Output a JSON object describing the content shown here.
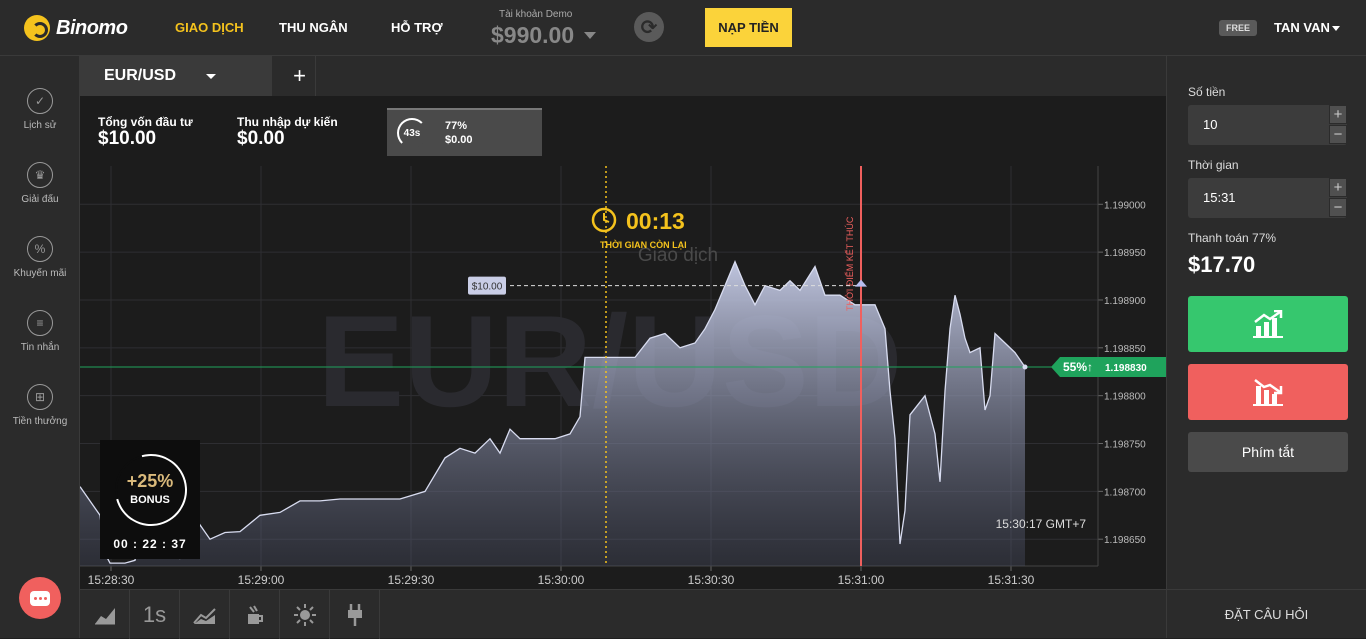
{
  "header": {
    "brand": "Binomo",
    "nav": {
      "trade": "GIAO DỊCH",
      "cashier": "THU NGÂN",
      "support": "HỖ TRỢ"
    },
    "account_label": "Tài khoản Demo",
    "balance": "$990.00",
    "deposit_label": "NẠP TIỀN",
    "free_badge": "FREE",
    "username": "TAN VAN"
  },
  "sidebar": {
    "items": [
      {
        "label": "Lịch sử",
        "icon": "check-circle-icon"
      },
      {
        "label": "Giải đấu",
        "icon": "trophy-icon"
      },
      {
        "label": "Khuyến mãi",
        "icon": "percent-icon"
      },
      {
        "label": "Tin nhắn",
        "icon": "message-lines-icon"
      },
      {
        "label": "Tiền thưởng",
        "icon": "gift-icon"
      }
    ]
  },
  "asset_tab": {
    "name": "EUR/USD",
    "add": "+"
  },
  "info": {
    "invest_label": "Tổng vốn đầu tư",
    "invest_value": "$10.00",
    "income_label": "Thu nhập dự kiến",
    "income_value": "$0.00",
    "deal": {
      "timer": "43s",
      "percent": "77%",
      "amount": "$0.00"
    }
  },
  "chart_data": {
    "type": "area",
    "watermark": "EUR/USD",
    "countdown": "00:13",
    "countdown_label": "THỜI GIAN CÒN LẠI",
    "trade_label": "Giao dịch",
    "expiry_label": "THỜI ĐIỂM KẾT THÚC",
    "deal_tag": "$10.00",
    "current_tag_pct": "55%↑",
    "current_price": "1.198830",
    "server_time": "15:30:17 GMT+7",
    "x_ticks": [
      "15:28:30",
      "15:29:00",
      "15:29:30",
      "15:30:00",
      "15:30:30",
      "15:31:00",
      "15:31:30"
    ],
    "y_ticks": [
      "1.199000",
      "1.198950",
      "1.198900",
      "1.198850",
      "1.198800",
      "1.198750",
      "1.198700",
      "1.198650"
    ],
    "ylim": [
      1.198622,
      1.19904
    ],
    "deal_price": 1.198915,
    "purchase_time_s": 105,
    "expiry_time_s": 150,
    "series": [
      [
        0,
        1.198705
      ],
      [
        4,
        1.198675
      ],
      [
        5,
        1.198635
      ],
      [
        6,
        1.198625
      ],
      [
        9,
        1.198625
      ],
      [
        11,
        1.198628
      ],
      [
        12,
        1.198655
      ],
      [
        15,
        1.198645
      ],
      [
        17,
        1.198665
      ],
      [
        18,
        1.19865
      ],
      [
        20,
        1.19863
      ],
      [
        22,
        1.198645
      ],
      [
        24,
        1.198665
      ],
      [
        26,
        1.19865
      ],
      [
        29,
        1.198657
      ],
      [
        32,
        1.198658
      ],
      [
        36,
        1.198675
      ],
      [
        40,
        1.198678
      ],
      [
        44,
        1.19869
      ],
      [
        48,
        1.19869
      ],
      [
        52,
        1.198692
      ],
      [
        56,
        1.198692
      ],
      [
        60,
        1.198692
      ],
      [
        64,
        1.198692
      ],
      [
        69,
        1.1987
      ],
      [
        73,
        1.198735
      ],
      [
        76,
        1.198745
      ],
      [
        79,
        1.19874
      ],
      [
        82,
        1.198755
      ],
      [
        84,
        1.19874
      ],
      [
        86,
        1.198765
      ],
      [
        88,
        1.198755
      ],
      [
        91,
        1.198755
      ],
      [
        95,
        1.198755
      ],
      [
        98,
        1.19876
      ],
      [
        100,
        1.198778
      ],
      [
        101,
        1.19884
      ],
      [
        103,
        1.19884
      ],
      [
        107,
        1.19884
      ],
      [
        111,
        1.19884
      ],
      [
        114,
        1.19886
      ],
      [
        117,
        1.198865
      ],
      [
        120,
        1.19885
      ],
      [
        123,
        1.198855
      ],
      [
        125,
        1.19887
      ],
      [
        127,
        1.19889
      ],
      [
        131,
        1.19894
      ],
      [
        133,
        1.198915
      ],
      [
        135,
        1.198895
      ],
      [
        137,
        1.198915
      ],
      [
        140,
        1.19891
      ],
      [
        142,
        1.19892
      ],
      [
        144,
        1.19891
      ],
      [
        147,
        1.198935
      ],
      [
        149,
        1.198905
      ],
      [
        152,
        1.198905
      ],
      [
        155,
        1.198895
      ],
      [
        159,
        1.198895
      ],
      [
        161,
        1.19887
      ],
      [
        162,
        1.198805
      ],
      [
        163,
        1.198755
      ],
      [
        164,
        1.198645
      ],
      [
        165,
        1.19868
      ],
      [
        166,
        1.19878
      ],
      [
        169,
        1.1988
      ],
      [
        171,
        1.19876
      ],
      [
        172,
        1.19871
      ],
      [
        173,
        1.198805
      ],
      [
        174,
        1.19887
      ],
      [
        175,
        1.198905
      ],
      [
        176,
        1.198885
      ],
      [
        177,
        1.19886
      ],
      [
        178,
        1.198845
      ],
      [
        180,
        1.19885
      ],
      [
        181,
        1.198785
      ],
      [
        182,
        1.1988
      ],
      [
        183,
        1.198865
      ],
      [
        185,
        1.198855
      ],
      [
        187,
        1.198845
      ],
      [
        189,
        1.19883
      ]
    ]
  },
  "bonus": {
    "percent": "+25%",
    "label": "BONUS",
    "timer": "00 : 22 : 37"
  },
  "toolbar": {
    "items": [
      "chart-type-icon",
      "timeframe",
      "indicators-icon",
      "drawing-icon",
      "theme-icon",
      "plugin-icon"
    ],
    "timeframe": "1s"
  },
  "panel": {
    "amount_label": "Số tiền",
    "amount": "10",
    "time_label": "Thời gian",
    "time": "15:31",
    "payout_label": "Thanh toán 77%",
    "payout_value": "$17.70",
    "up_icon": "chart-up-icon",
    "down_icon": "chart-down-icon",
    "shortcut": "Phím tắt",
    "ask": "ĐẶT CÂU HỎI"
  },
  "colors": {
    "accent": "#f4c21d",
    "up": "#36c76e",
    "down": "#f0605e",
    "price_line": "#1fa35c",
    "expiry_line": "#f0605e"
  }
}
